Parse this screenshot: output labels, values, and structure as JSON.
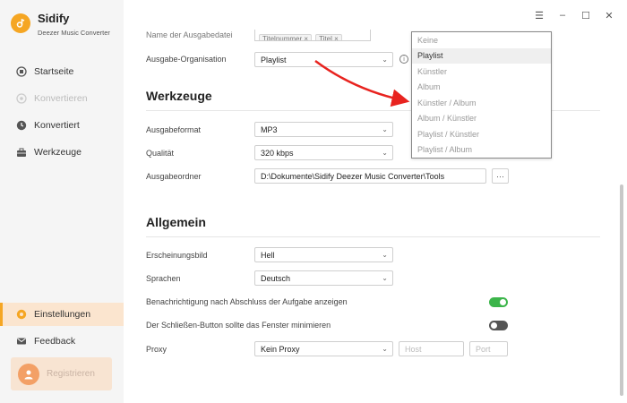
{
  "app": {
    "name": "Sidify",
    "subtitle": "Deezer Music Converter"
  },
  "nav": {
    "items": [
      {
        "label": "Startseite",
        "icon": "home-icon",
        "state": "normal"
      },
      {
        "label": "Konvertieren",
        "icon": "convert-icon",
        "state": "disabled"
      },
      {
        "label": "Konvertiert",
        "icon": "clock-icon",
        "state": "normal"
      },
      {
        "label": "Werkzeuge",
        "icon": "toolbox-icon",
        "state": "normal"
      }
    ],
    "bottom": [
      {
        "label": "Einstellungen",
        "icon": "gear-icon",
        "state": "active"
      },
      {
        "label": "Feedback",
        "icon": "mail-icon",
        "state": "normal"
      }
    ],
    "register_label": "Registrieren"
  },
  "window": {
    "menu": "☰",
    "minimize": "–",
    "maximize": "☐",
    "close": "✕"
  },
  "output": {
    "filename_label": "Name der Ausgabedatei",
    "filename_tags": [
      "Titelnummer ×",
      "Titel ×"
    ],
    "organisation_label": "Ausgabe-Organisation",
    "organisation_value": "Playlist"
  },
  "tools": {
    "title": "Werkzeuge",
    "format_label": "Ausgabeformat",
    "format_value": "MP3",
    "quality_label": "Qualität",
    "quality_value": "320 kbps",
    "folder_label": "Ausgabeordner",
    "folder_value": "D:\\Dokumente\\Sidify Deezer Music Converter\\Tools",
    "browse_label": "···"
  },
  "general": {
    "title": "Allgemein",
    "appearance_label": "Erscheinungsbild",
    "appearance_value": "Hell",
    "language_label": "Sprachen",
    "language_value": "Deutsch",
    "notify_label": "Benachrichtigung nach Abschluss der Aufgabe anzeigen",
    "notify_on": true,
    "close_label": "Der Schließen-Button sollte das Fenster minimieren",
    "close_on": false,
    "proxy_label": "Proxy",
    "proxy_value": "Kein Proxy",
    "host_placeholder": "Host",
    "port_placeholder": "Port"
  },
  "dropdown": {
    "options": [
      "Keine",
      "Playlist",
      "Künstler",
      "Album",
      "Künstler / Album",
      "Album / Künstler",
      "Playlist / Künstler",
      "Playlist / Album"
    ],
    "selected": "Playlist"
  },
  "colors": {
    "accent": "#f5a623",
    "active_bg": "#fbe5cf",
    "toggle_on": "#3cb54a",
    "arrow": "#e8231f"
  }
}
